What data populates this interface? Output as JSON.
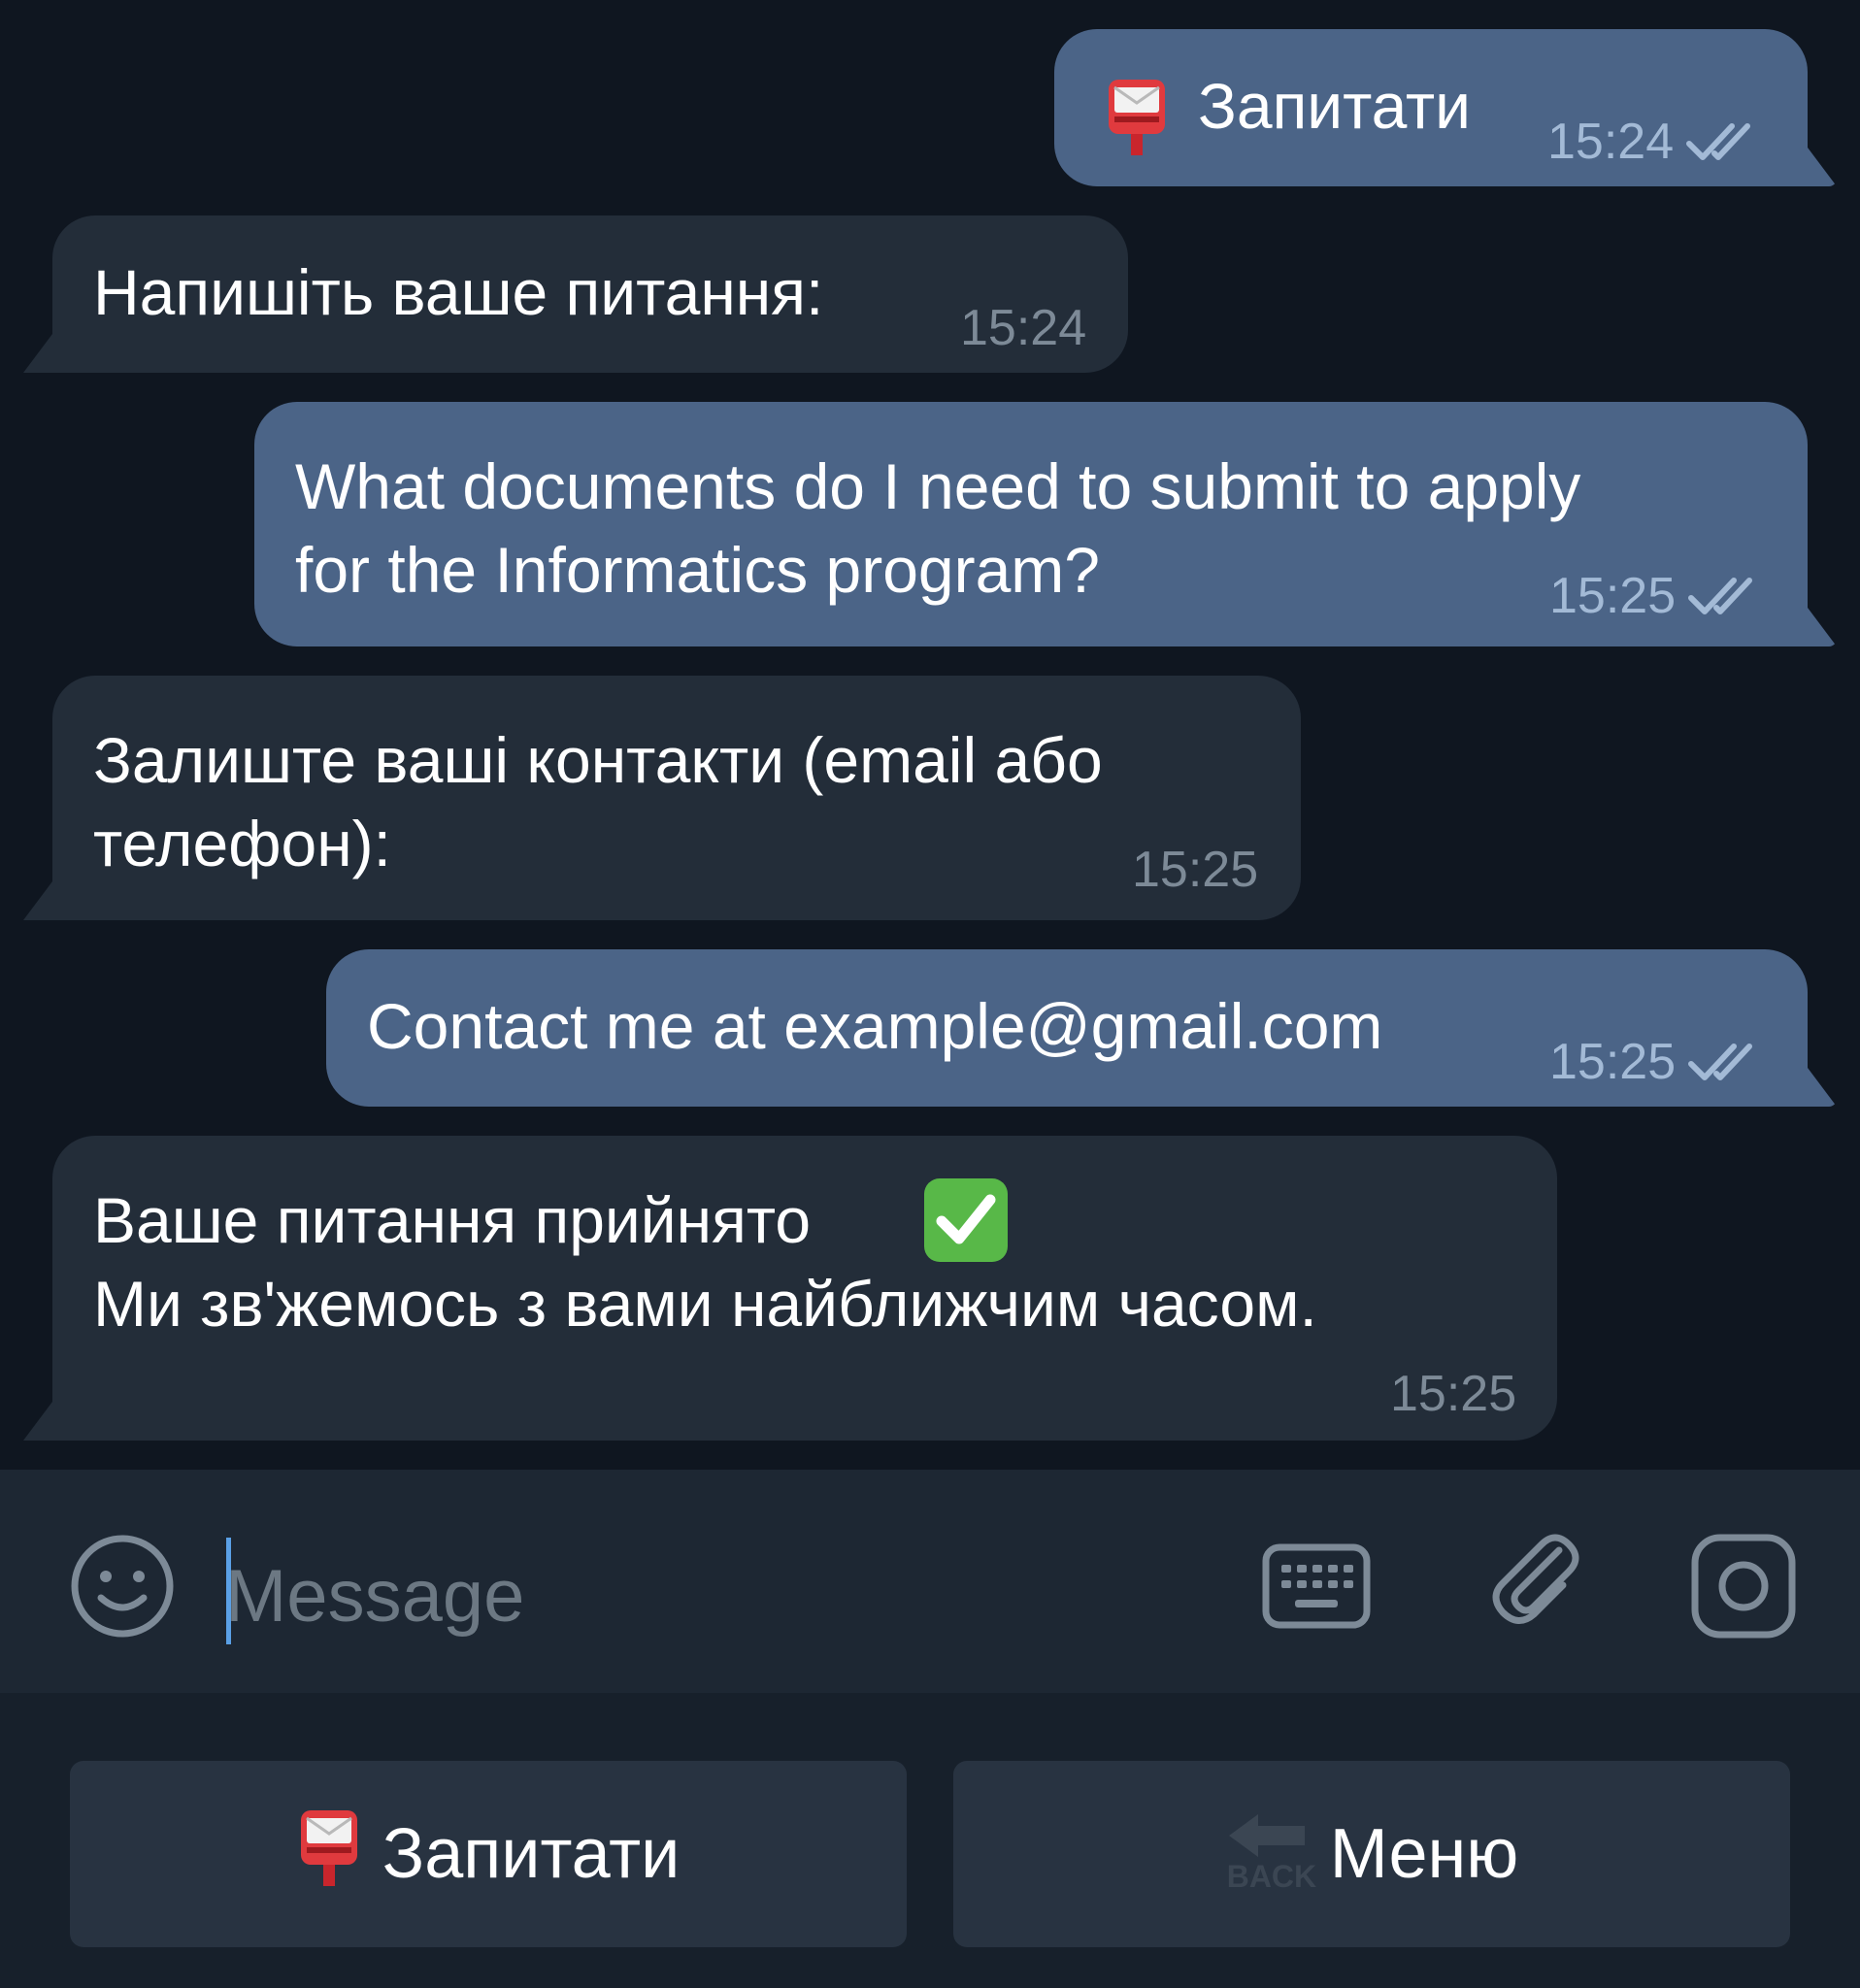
{
  "messages": [
    {
      "direction": "out",
      "emoji": "postbox-icon",
      "text": "Запитати",
      "time": "15:24",
      "status": "read"
    },
    {
      "direction": "in",
      "text": "Напишіть ваше питання:",
      "time": "15:24"
    },
    {
      "direction": "out",
      "text_line1": "What documents do I need to submit to apply",
      "text_line2": "for the Informatics program?",
      "time": "15:25",
      "status": "read"
    },
    {
      "direction": "in",
      "text_line1": "Залиште ваші контакти (email або",
      "text_line2": "телефон):",
      "time": "15:25"
    },
    {
      "direction": "out",
      "text": "Contact me at example@gmail.com",
      "time": "15:25",
      "status": "read"
    },
    {
      "direction": "in",
      "text_line1": "Ваше питання прийнято",
      "emoji": "check-mark-icon",
      "text_line2": "Ми зв'жемось з вами найближчим часом.",
      "time": "15:25"
    }
  ],
  "composer": {
    "placeholder": "Message"
  },
  "keyboard": {
    "buttons": [
      {
        "label": "Запитати",
        "icon": "postbox-icon"
      },
      {
        "label": "Меню",
        "icon": "back-arrow-icon",
        "icon_text": "BACK"
      }
    ]
  },
  "colors": {
    "chat_bg": "#0f1620",
    "outgoing_bubble": "#4b6487",
    "incoming_bubble": "#232d39",
    "composer_bg": "#1d2733",
    "keyboard_bg": "#17202b",
    "keyboard_button": "#283341",
    "accent": "#5aa0e6"
  }
}
